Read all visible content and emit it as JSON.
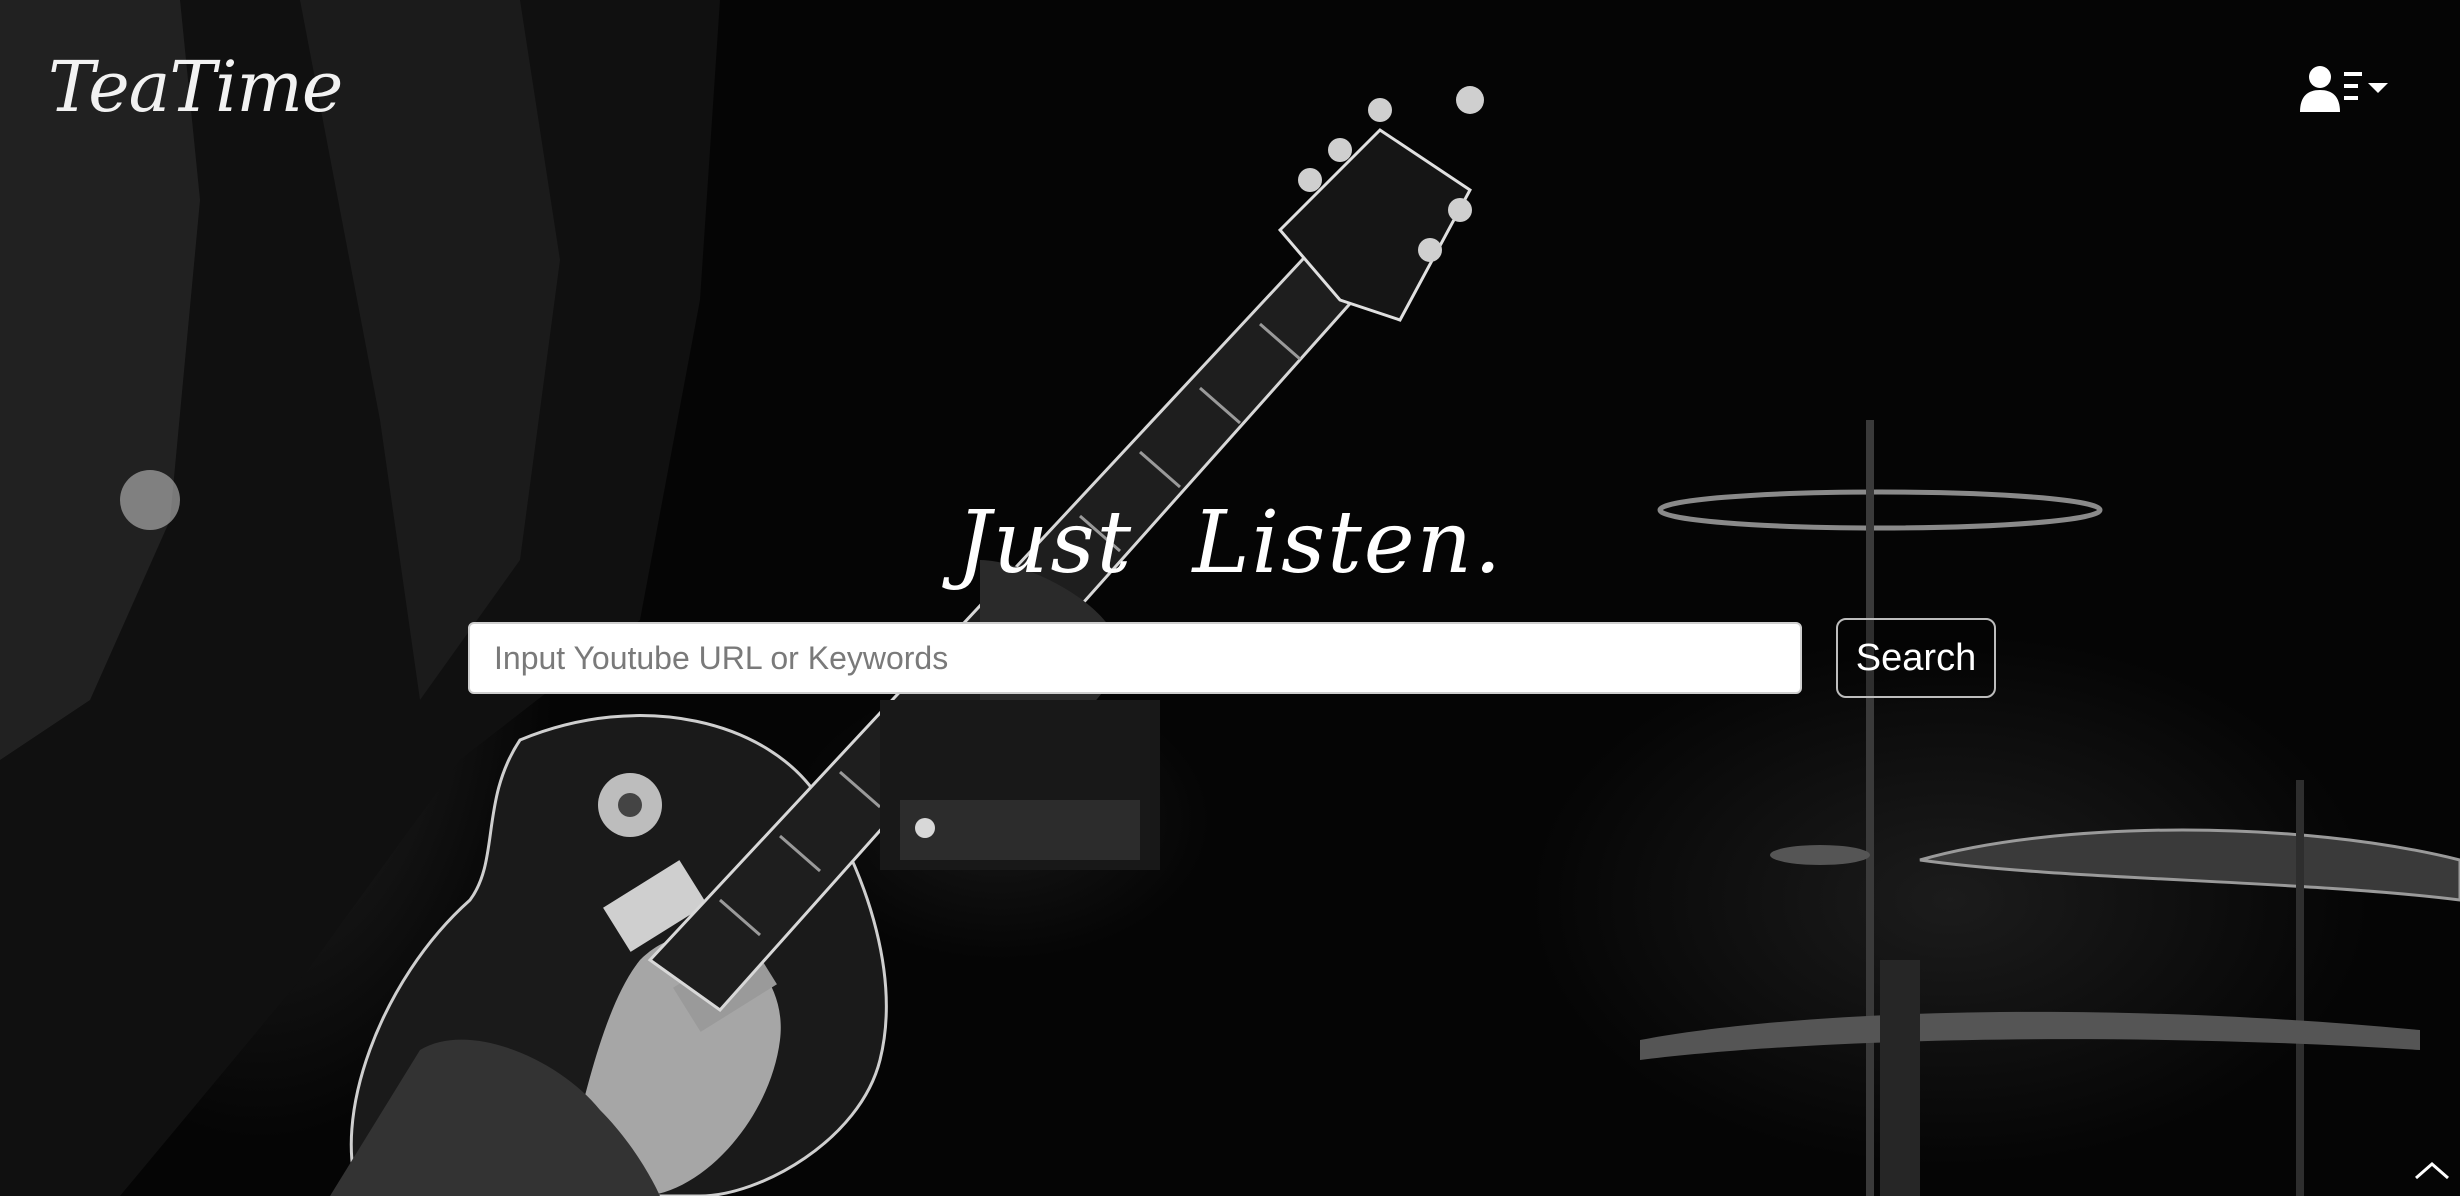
{
  "brand": {
    "name": "TeaTime"
  },
  "hero": {
    "tagline": "Just  Listen."
  },
  "search": {
    "placeholder": "Input Youtube URL or Keywords",
    "value": "",
    "button_label": "Search"
  },
  "icons": {
    "user_menu": "user-icon",
    "menu_lines": "list-icon",
    "dropdown": "caret-down-icon",
    "scroll_top": "chevron-up-icon"
  },
  "colors": {
    "background": "#050505",
    "text": "#ffffff",
    "input_background": "#ffffff",
    "button_border": "#bdbdbd"
  }
}
